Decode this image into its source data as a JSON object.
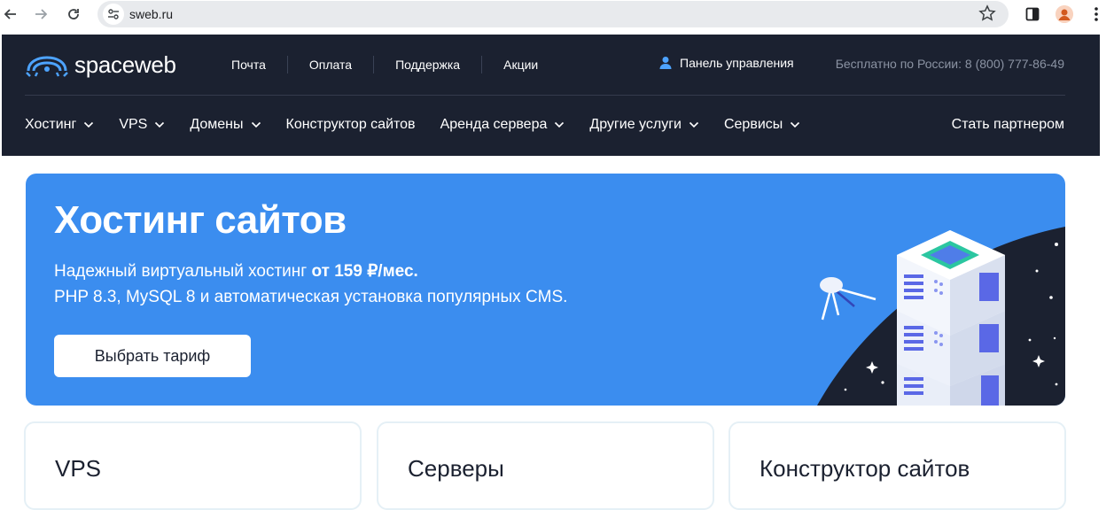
{
  "browser": {
    "url": "sweb.ru"
  },
  "header": {
    "logo_text": "spaceweb",
    "top_links": [
      "Почта",
      "Оплата",
      "Поддержка",
      "Акции"
    ],
    "panel_label": "Панель управления",
    "phone_text": "Бесплатно по России: 8 (800) 777-86-49"
  },
  "nav": {
    "items": [
      {
        "label": "Хостинг",
        "dropdown": true
      },
      {
        "label": "VPS",
        "dropdown": true
      },
      {
        "label": "Домены",
        "dropdown": true
      },
      {
        "label": "Конструктор сайтов",
        "dropdown": false
      },
      {
        "label": "Аренда сервера",
        "dropdown": true
      },
      {
        "label": "Другие услуги",
        "dropdown": true
      },
      {
        "label": "Сервисы",
        "dropdown": true
      }
    ],
    "partner_label": "Стать партнером"
  },
  "hero": {
    "title": "Хостинг сайтов",
    "subtitle_prefix": "Надежный виртуальный хостинг ",
    "subtitle_price": "от 159 ₽/мес.",
    "subtitle_line2": "PHP 8.3, MySQL 8 и автоматическая установка популярных CMS.",
    "cta_label": "Выбрать тариф"
  },
  "cards": [
    {
      "title": "VPS"
    },
    {
      "title": "Серверы"
    },
    {
      "title": "Конструктор сайтов"
    }
  ],
  "colors": {
    "header_bg": "#1b2130",
    "hero_bg": "#3b8def",
    "accent": "#3b8def"
  }
}
